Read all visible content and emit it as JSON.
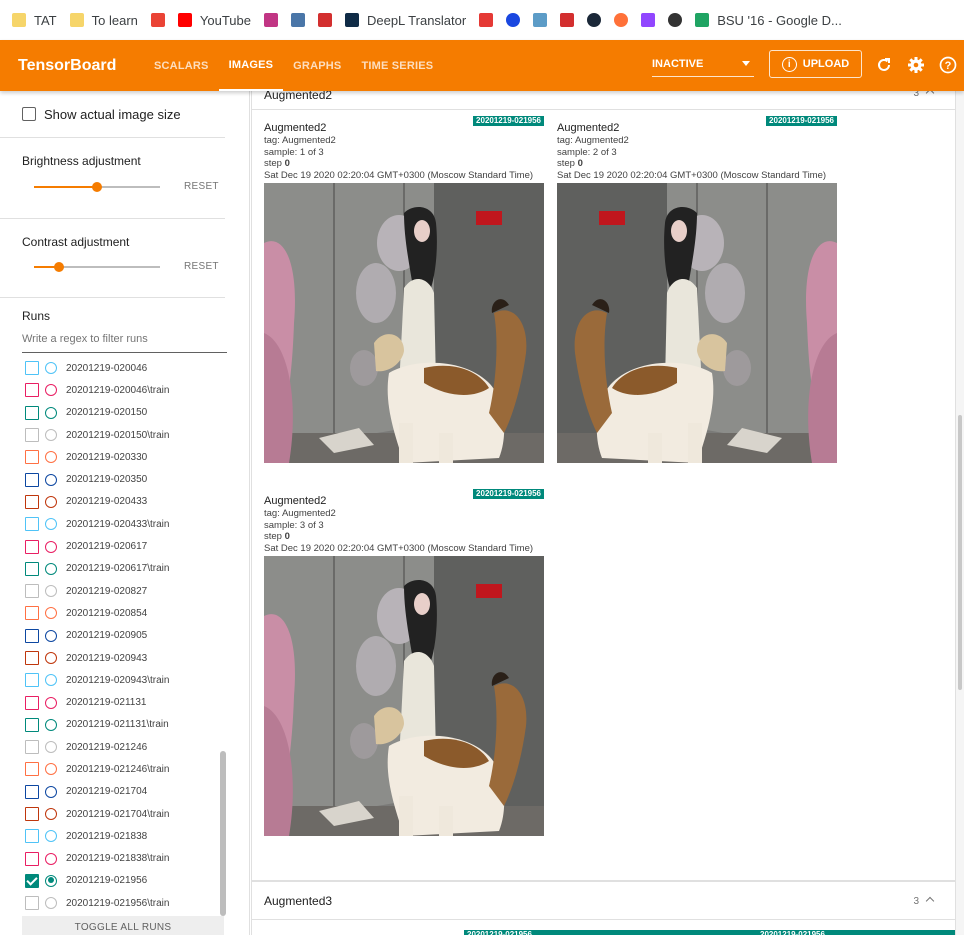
{
  "bookmarks": [
    {
      "label": "TAT",
      "icon": "folder-icon",
      "color": "#f6d56a"
    },
    {
      "label": "To learn",
      "icon": "folder-icon",
      "color": "#f6d56a"
    },
    {
      "label": "",
      "icon": "gmail-icon",
      "color": "#ea4335"
    },
    {
      "label": "YouTube",
      "icon": "youtube-icon",
      "color": "#ff0000"
    },
    {
      "label": "",
      "icon": "instagram-icon",
      "color": "#c13584"
    },
    {
      "label": "",
      "icon": "vk-icon",
      "color": "#4a76a8"
    },
    {
      "label": "",
      "icon": "bookmark-icon",
      "color": "#d32f2f"
    },
    {
      "label": "DeepL Translator",
      "icon": "deepl-icon",
      "color": "#0f2b46"
    },
    {
      "label": "",
      "icon": "info-bookmark-icon",
      "color": "#e53935"
    },
    {
      "label": "",
      "icon": "circle-bookmark-icon",
      "color": "#1a47e0"
    },
    {
      "label": "",
      "icon": "gear-bookmark-icon",
      "color": "#5c9cc7"
    },
    {
      "label": "",
      "icon": "shield-bookmark-icon",
      "color": "#d32f2f"
    },
    {
      "label": "",
      "icon": "steam-icon",
      "color": "#1b2838"
    },
    {
      "label": "",
      "icon": "firefox-icon",
      "color": "#ff7139"
    },
    {
      "label": "",
      "icon": "twitch-icon",
      "color": "#9146ff"
    },
    {
      "label": "",
      "icon": "avatar-bookmark-icon",
      "color": "#333333"
    },
    {
      "label": "BSU '16 - Google D...",
      "icon": "google-drive-icon",
      "color": "#1fa463"
    }
  ],
  "appbar": {
    "brand": "TensorBoard",
    "tabs": [
      {
        "label": "Scalars",
        "active": false
      },
      {
        "label": "Images",
        "active": true
      },
      {
        "label": "Graphs",
        "active": false
      },
      {
        "label": "Time Series",
        "active": false
      }
    ],
    "reload_select": "INACTIVE",
    "upload_label": "UPLOAD",
    "accent": "#f57c00"
  },
  "sidebar": {
    "show_actual_size": "Show actual image size",
    "brightness_label": "Brightness adjustment",
    "brightness_value": 0.5,
    "contrast_label": "Contrast adjustment",
    "contrast_value": 0.2,
    "reset_label": "RESET",
    "runs_title": "Runs",
    "runs_filter_placeholder": "Write a regex to filter runs",
    "toggle_all": "TOGGLE ALL RUNS",
    "runs": [
      {
        "name": "20201219-020046",
        "color": "#4fc3f7",
        "checked": false
      },
      {
        "name": "20201219-020046\\train",
        "color": "#e91e63",
        "checked": false
      },
      {
        "name": "20201219-020150",
        "color": "#00897b",
        "checked": false
      },
      {
        "name": "20201219-020150\\train",
        "color": "#bdbdbd",
        "checked": false
      },
      {
        "name": "20201219-020330",
        "color": "#ff7043",
        "checked": false
      },
      {
        "name": "20201219-020350",
        "color": "#0d47a1",
        "checked": false
      },
      {
        "name": "20201219-020433",
        "color": "#bf360c",
        "checked": false
      },
      {
        "name": "20201219-020433\\train",
        "color": "#4fc3f7",
        "checked": false
      },
      {
        "name": "20201219-020617",
        "color": "#e91e63",
        "checked": false
      },
      {
        "name": "20201219-020617\\train",
        "color": "#00897b",
        "checked": false
      },
      {
        "name": "20201219-020827",
        "color": "#bdbdbd",
        "checked": false
      },
      {
        "name": "20201219-020854",
        "color": "#ff7043",
        "checked": false
      },
      {
        "name": "20201219-020905",
        "color": "#0d47a1",
        "checked": false
      },
      {
        "name": "20201219-020943",
        "color": "#bf360c",
        "checked": false
      },
      {
        "name": "20201219-020943\\train",
        "color": "#4fc3f7",
        "checked": false
      },
      {
        "name": "20201219-021131",
        "color": "#e91e63",
        "checked": false
      },
      {
        "name": "20201219-021131\\train",
        "color": "#00897b",
        "checked": false
      },
      {
        "name": "20201219-021246",
        "color": "#bdbdbd",
        "checked": false
      },
      {
        "name": "20201219-021246\\train",
        "color": "#ff7043",
        "checked": false
      },
      {
        "name": "20201219-021704",
        "color": "#0d47a1",
        "checked": false
      },
      {
        "name": "20201219-021704\\train",
        "color": "#bf360c",
        "checked": false
      },
      {
        "name": "20201219-021838",
        "color": "#4fc3f7",
        "checked": false
      },
      {
        "name": "20201219-021838\\train",
        "color": "#e91e63",
        "checked": false
      },
      {
        "name": "20201219-021956",
        "color": "#00897b",
        "checked": true
      },
      {
        "name": "20201219-021956\\train",
        "color": "#bdbdbd",
        "checked": false
      }
    ]
  },
  "main": {
    "card1": {
      "title": "Augmented2",
      "count": "3"
    },
    "card2": {
      "title": "Augmented3",
      "count": "3"
    },
    "images": [
      {
        "name": "Augmented2",
        "tag": "tag: Augmented2",
        "sample": "sample: 1 of 3",
        "step_label": "step",
        "step": "0",
        "time": "Sat Dec 19 2020 02:20:04 GMT+0300 (Moscow Standard Time)",
        "run": "20201219-021956"
      },
      {
        "name": "Augmented2",
        "tag": "tag: Augmented2",
        "sample": "sample: 2 of 3",
        "step_label": "step",
        "step": "0",
        "time": "Sat Dec 19 2020 02:20:04 GMT+0300 (Moscow Standard Time)",
        "run": "20201219-021956"
      },
      {
        "name": "Augmented2",
        "tag": "tag: Augmented2",
        "sample": "sample: 3 of 3",
        "step_label": "step",
        "step": "0",
        "time": "Sat Dec 19 2020 02:20:04 GMT+0300 (Moscow Standard Time)",
        "run": "20201219-021956"
      }
    ],
    "next_card_chip": "20201219-021956"
  }
}
